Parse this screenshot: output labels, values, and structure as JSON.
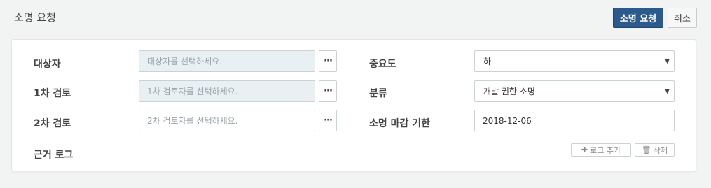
{
  "header": {
    "title": "소명 요청",
    "submit_label": "소명 요청",
    "cancel_label": "취소"
  },
  "form": {
    "target": {
      "label": "대상자",
      "placeholder": "대상자를 선택하세요."
    },
    "review1": {
      "label": "1차 검토",
      "placeholder": "1차 검토자를 선택하세요."
    },
    "review2": {
      "label": "2차 검토",
      "placeholder": "2차 검토자를 선택하세요."
    },
    "importance": {
      "label": "중요도",
      "value": "하"
    },
    "category": {
      "label": "분류",
      "value": "개발 권한 소명"
    },
    "deadline": {
      "label": "소명 마감 기한",
      "value": "2018-12-06"
    },
    "evidence": {
      "label": "근거 로그",
      "add_label": "로그 추가",
      "delete_label": "삭제"
    },
    "browse_glyph": "···"
  },
  "icons": {
    "caret": "caret-down-icon",
    "plus": "plus-icon",
    "trash": "trash-icon",
    "browse": "ellipsis-icon"
  },
  "colors": {
    "primary": "#2c5a8a",
    "readonly_bg": "#e8f0f3"
  }
}
